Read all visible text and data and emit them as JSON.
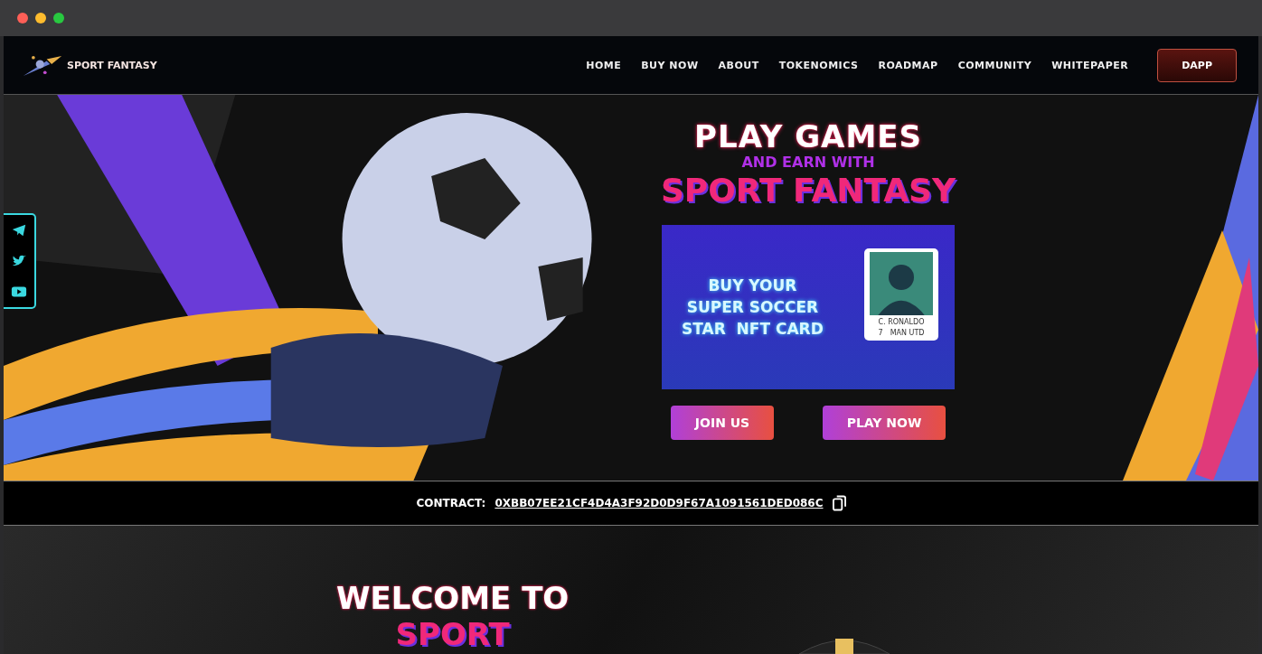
{
  "brand": {
    "name": "SPORT FANTASY"
  },
  "nav": {
    "items": [
      {
        "label": "HOME"
      },
      {
        "label": "BUY NOW"
      },
      {
        "label": "ABOUT"
      },
      {
        "label": "TOKENOMICS"
      },
      {
        "label": "ROADMAP"
      },
      {
        "label": "COMMUNITY"
      },
      {
        "label": "WHITEPAPER"
      }
    ],
    "button": "DAPP"
  },
  "social": [
    {
      "kind": "telegram"
    },
    {
      "kind": "twitter"
    },
    {
      "kind": "youtube"
    }
  ],
  "hero": {
    "title": "PLAY GAMES",
    "subtitle": "AND EARN WITH",
    "brand": "SPORT FANTASY",
    "banner": {
      "lines": [
        "BUY YOUR",
        "SUPER SOCCER",
        "STAR  NFT CARD"
      ],
      "player": {
        "name": "C. RONALDO",
        "number": "7",
        "team": "MAN UTD"
      }
    },
    "buttons": [
      "JOIN US",
      "PLAY NOW"
    ]
  },
  "contract": {
    "label": "CONTRACT:",
    "address": "0XBB07EE21CF4D4A3F92D0D9F67A1091561DED086C"
  },
  "welcome": {
    "title": "WELCOME TO",
    "brand": "SPORT"
  }
}
